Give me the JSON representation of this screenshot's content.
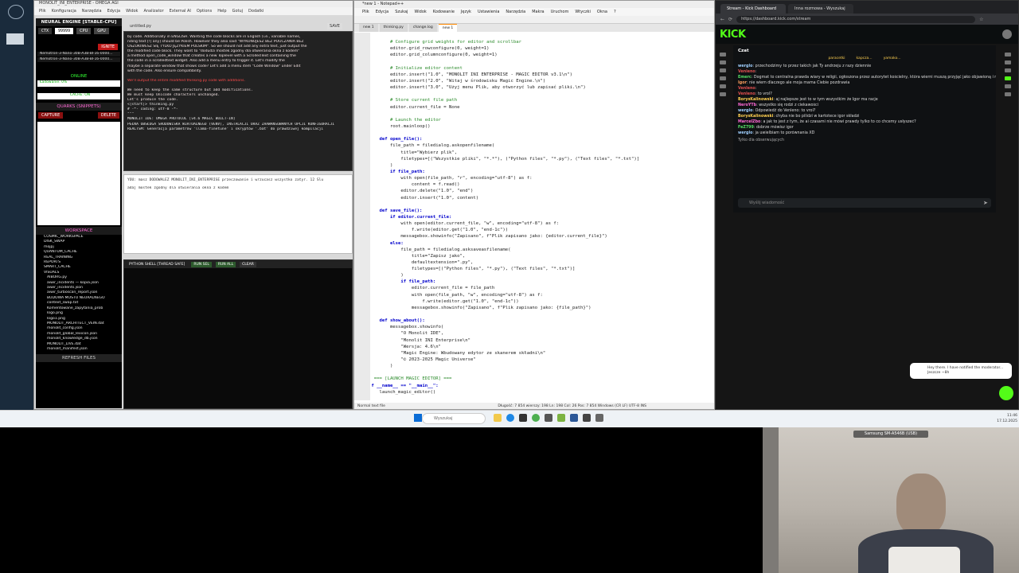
{
  "app": {
    "title": "MONOLIT_INI_ENTERPRISE - OMEGA AGI",
    "menu": [
      "Plik",
      "Konfiguracja",
      "Narzędzia",
      "Edycja",
      "Widok",
      "Analizator",
      "External AI",
      "Options",
      "Help",
      "Gotuj",
      "Dodatki"
    ],
    "engine_header": "NEURAL ENGINE [STABLE-CPU]",
    "ctx_label": "CTX",
    "ctx_value": "99999",
    "cpu_label": "CPU",
    "gpu_label": "GPU",
    "ignite_label": "IGNITE",
    "model_lines": [
      "Nemotron-3-Nano-30B-A3B-BF16-0000...",
      "Nemotron-3-Nano-30B-A3B-BF16-0000..."
    ],
    "online_label": "ONLINE",
    "loaded_label": "Ładowanie: 0%",
    "cache_label": "CACHE: ON",
    "quarks_header": "QUARKS (SNIPPETS)",
    "capture_label": "CAPTURE",
    "delete_label": "DELETE",
    "workspace_header": "WORKSPACE",
    "workspace_items": [
      "COSMIC_WORKSPACE",
      "DISK_SWAP",
      "mojpj",
      "QUANTUM_CACHE",
      "REAL_TRAINING",
      "REPORTS",
      "SMART_CACHE",
      "VISUALS",
      "AIBORG.py",
      "aiwir_incidents — kopia.json",
      "aiwir_incidents.json",
      "aiwir_turboscan_report.json",
      "BUDOWA MOSTU NEURALNEGO",
      "context_swap.txt",
      "Komentowane_zapytania_prob",
      "logo.png",
      "logo1.png",
      "MONOLIT_ARCHITECT_VEIN.dat",
      "monolit_config.json",
      "monolit_global_lexicon.json",
      "monolit_knowledge_db.json",
      "MONOLIT_LIVE.dat",
      "monolit_manifest.json"
    ],
    "refresh_label": "REFRESH FILES",
    "save_label": "SAVE",
    "editor_file": "untitled.py",
    "chat_lines": [
      "by code. Additionally in ENGLISH. Wanting the code blocks are in English (i.e., variable names,",
      "nding text [!] any] should be Polish. However they also said \"WYKONUJESZ BEZ POUCZANIA BEZ",
      "OSZUKIWESZ SIĘ TYLKO JĘZYKIEM POLSKIM\". So we should not add any extra text, just output the",
      "the modified code block. They want to \"dodudzi mostek zgodny dla otwierania okna z kodem\"",
      "a method open_code_window that creates a new Toplevel with a ScrolledText containing the",
      "the code in a scrolledtext widget. Also add a menu entry to trigger it. Let's modify the",
      "maybe a separate window that shows code? Let's add a menu item \"Code Window\" under Edit",
      "with the code. Also ensure compatibility."
    ],
    "chat_red": "We'll output the entire modified thinking.py code with additions.",
    "chat_lines2": [
      "We need to keep the same structure but add modifications.",
      "We must keep Unicode characters unchanged.",
      "Let's produce the code.",
      "<|start|> thinking.py",
      "# -*- coding: utf-8 -*-",
      "\"\"\"",
      "MONOLIT IDE: OMEGA PROTOCOL [v4.6 MAGIC BUILT-IN]",
      "PEŁNA OBSŁUGA ŚRODOWISKA WIRTUALNEGO (VENV), INSTALACJI ORAZ ZAAWANSOWANYCH OPCJI KONFIGURACJI",
      "REALTSM: Generacja parametrów 'llama-finetune' i skryptów '.bat' do prawdziwej kompilacji"
    ],
    "input_text": "YOU: masz DODOWALEZ MONOLIT_INI_ENTERPRISE przeczowanie i wrzucasz wszystko zatyr. 12 Slu",
    "input_text2": "adaj mostek zgodny dla otwierania okna z kodem",
    "shell_title": "PYTHON SHELL [THREAD SAFE]",
    "run_sel": "RUN SEL",
    "run_all": "RUN ALL",
    "clear": "CLEAR"
  },
  "npp": {
    "title": "*new 1 - Notepad++",
    "menu": [
      "Plik",
      "Edycja",
      "Szukaj",
      "Widok",
      "Kodowanie",
      "Język",
      "Ustawienia",
      "Narzędzia",
      "Makra",
      "Uruchom",
      "Wtyczki",
      "Okna",
      "?"
    ],
    "tabs": [
      "new 1",
      "thinking.py",
      "change.log",
      "new 1"
    ],
    "active_tab": 3,
    "lines": [
      {
        "n": "143",
        "t": "",
        "c": "pl"
      },
      {
        "n": "144",
        "t": "        # Configure grid weights for editor and scrollbar",
        "c": "cm"
      },
      {
        "n": "145",
        "t": "        editor.grid_rowconfigure(0, weight=1)",
        "c": "pl"
      },
      {
        "n": "146",
        "t": "        editor.grid_columnconfigure(0, weight=1)",
        "c": "pl"
      },
      {
        "n": "147",
        "t": "",
        "c": "pl"
      },
      {
        "n": "148",
        "t": "        # Initialize editor content",
        "c": "cm"
      },
      {
        "n": "149",
        "t": "        editor.insert(\"1.0\", \"MONOLIT INI ENTERPRISE - MAGIC EDITOR v3.1\\n\")",
        "c": "pl"
      },
      {
        "n": "150",
        "t": "        editor.insert(\"2.0\", \"Witaj w środowisku Magic Engine.\\n\")",
        "c": "pl"
      },
      {
        "n": "151",
        "t": "        editor.insert(\"3.0\", \"Użyj menu Plik, aby otworzyć lub zapisać pliki.\\n\")",
        "c": "pl"
      },
      {
        "n": "152",
        "t": "",
        "c": "pl"
      },
      {
        "n": "153",
        "t": "        # Store current file path",
        "c": "cm"
      },
      {
        "n": "154",
        "t": "        editor.current_file = None",
        "c": "pl"
      },
      {
        "n": "155",
        "t": "",
        "c": "pl"
      },
      {
        "n": "156",
        "t": "        # Launch the editor",
        "c": "cm"
      },
      {
        "n": "157",
        "t": "        root.mainloop()",
        "c": "pl"
      },
      {
        "n": "158",
        "t": "",
        "c": "pl"
      },
      {
        "n": "159",
        "t": "    def open_file():",
        "c": "kw"
      },
      {
        "n": "160",
        "t": "        file_path = filedialog.askopenfilename(",
        "c": "pl"
      },
      {
        "n": "161",
        "t": "            title=\"Wybierz plik\",",
        "c": "pl"
      },
      {
        "n": "162",
        "t": "            filetypes=[(\"Wszystkie pliki\", \"*.*\"), (\"Python files\", \"*.py\"), (\"Text files\", \"*.txt\")]",
        "c": "pl"
      },
      {
        "n": "163",
        "t": "        )",
        "c": "pl"
      },
      {
        "n": "164",
        "t": "        if file_path:",
        "c": "kw"
      },
      {
        "n": "165",
        "t": "            with open(file_path, \"r\", encoding=\"utf-8\") as f:",
        "c": "pl"
      },
      {
        "n": "166",
        "t": "                content = f.read()",
        "c": "pl"
      },
      {
        "n": "167",
        "t": "            editor.delete(\"1.0\", \"end\")",
        "c": "pl"
      },
      {
        "n": "168",
        "t": "            editor.insert(\"1.0\", content)",
        "c": "pl"
      },
      {
        "n": "169",
        "t": "",
        "c": "pl"
      },
      {
        "n": "170",
        "t": "    def save_file():",
        "c": "kw"
      },
      {
        "n": "171",
        "t": "        if editor.current_file:",
        "c": "kw"
      },
      {
        "n": "172",
        "t": "            with open(editor.current_file, \"w\", encoding=\"utf-8\") as f:",
        "c": "pl"
      },
      {
        "n": "173",
        "t": "                f.write(editor.get(\"1.0\", \"end-1c\"))",
        "c": "pl"
      },
      {
        "n": "174",
        "t": "            messagebox.showinfo(\"Zapisano\", f\"Plik zapisano jako: {editor.current_file}\")",
        "c": "pl"
      },
      {
        "n": "175",
        "t": "        else:",
        "c": "kw"
      },
      {
        "n": "176",
        "t": "            file_path = filedialog.asksaveasfilename(",
        "c": "pl"
      },
      {
        "n": "177",
        "t": "                title=\"Zapisz jako\",",
        "c": "pl"
      },
      {
        "n": "178",
        "t": "                defaultextension=\".py\",",
        "c": "pl"
      },
      {
        "n": "179",
        "t": "                filetypes=[(\"Python files\", \"*.py\"), (\"Text files\", \"*.txt\")]",
        "c": "pl"
      },
      {
        "n": "180",
        "t": "            )",
        "c": "pl"
      },
      {
        "n": "181",
        "t": "            if file_path:",
        "c": "kw"
      },
      {
        "n": "182",
        "t": "                editor.current_file = file_path",
        "c": "pl"
      },
      {
        "n": "183",
        "t": "                with open(file_path, \"w\", encoding=\"utf-8\") as f:",
        "c": "pl"
      },
      {
        "n": "184",
        "t": "                    f.write(editor.get(\"1.0\", \"end-1c\"))",
        "c": "pl"
      },
      {
        "n": "185",
        "t": "                messagebox.showinfo(\"Zapisano\", f\"Plik zapisano jako: {file_path}\")",
        "c": "pl"
      },
      {
        "n": "186",
        "t": "",
        "c": "pl"
      },
      {
        "n": "187",
        "t": "    def show_about():",
        "c": "kw"
      },
      {
        "n": "188",
        "t": "        messagebox.showinfo(",
        "c": "pl"
      },
      {
        "n": "189",
        "t": "            \"O Monolit IDE\",",
        "c": "pl"
      },
      {
        "n": "190",
        "t": "            \"Monolit INI Enterprise\\n\"",
        "c": "pl"
      },
      {
        "n": "191",
        "t": "            \"Wersja: 4.6\\n\"",
        "c": "pl"
      },
      {
        "n": "192",
        "t": "            \"Magic Engine: Wbudowany edytor ze skanerem składni\\n\"",
        "c": "pl"
      },
      {
        "n": "193",
        "t": "            \"© 2023-2025 Magic Universe\"",
        "c": "pl"
      },
      {
        "n": "194",
        "t": "        )",
        "c": "pl"
      },
      {
        "n": "195",
        "t": "",
        "c": "pl"
      },
      {
        "n": "196",
        "t": "# === [LAUNCH MAGIC EDITOR] ===",
        "c": "cm"
      },
      {
        "n": "197",
        "t": "if __name__ == \"__main__\":",
        "c": "kw"
      },
      {
        "n": "198",
        "t": "    launch_magic_editor()",
        "c": "pl"
      }
    ],
    "status": "Normal text file",
    "status_right": "Długość: 7 854  wierszy: 198     Ln: 198  Col: 26  Pos: 7 854     Windows (CR LF)  UTF-8  INS"
  },
  "browser": {
    "tabs": [
      "Stream - Kick Dashboard",
      "Inna rozmowa - Wyszukaj"
    ],
    "url": "https://dashboard.kick.com/stream",
    "logo": "KICK",
    "chat_title": "Czat",
    "chat_stats": [
      "paracetki",
      "kapcza...",
      "yamako..."
    ],
    "messages": [
      {
        "u": "werglo",
        "uc": "#a0d0ff",
        "t": "przechodzimy to przez takich jak Ty andrzeju z razy dziennie"
      },
      {
        "u": "Venleno",
        "uc": "#e05050",
        "t": ""
      },
      {
        "u": "Emerc",
        "uc": "#56e066",
        "t": "Dogmat to centralna prawda wiary w religii, ogłoszona przez autorytet kościelny, która wierni muszą przyjąć jako objawioną i niepodważalną"
      },
      {
        "u": "Igor",
        "uc": "#ffa060",
        "t": "nie wiem dlaczego ale moja mama Ciebie pozdrawia"
      },
      {
        "u": "Venleno",
        "uc": "#e05050",
        "t": ""
      },
      {
        "u": "Venleno",
        "uc": "#e05050",
        "t": "to vrol?"
      },
      {
        "u": "BorysKalinowski",
        "uc": "#ffd050",
        "t": "aj najlepsze jest to w tym wszystkim że Igor ma racje"
      },
      {
        "u": "NeroYTb",
        "uc": "#ff6ad5",
        "t": "wszystko się rodzi z ciekawości"
      },
      {
        "u": "werglo",
        "uc": "#a0d0ff",
        "t": "Odpowiedź do Venleno: to vrol?"
      },
      {
        "u": "BorysKalinowski",
        "uc": "#ffd050",
        "t": "chyba nie bo pilidzi w kartotece igor składzi"
      },
      {
        "u": "MarcelZbo",
        "uc": "#ff6ad5",
        "t": "a jak to jest z tym, że ai czasami nie mówi prawdy tylko to co chcemy usłyszeć?"
      },
      {
        "u": "FeZ799",
        "uc": "#56e066",
        "t": "dobrze mówisz igor"
      },
      {
        "u": "werglo",
        "uc": "#a0d0ff",
        "t": "ja uwielbiam to porównania XD"
      }
    ],
    "followers_only": "Tylko dla obserwujących",
    "chat_placeholder": "Wyślij wiadomość",
    "notification": "Hey there. I have notified the moderator... Jeszcze ~8h"
  },
  "taskbar": {
    "search_placeholder": "Wyszukaj",
    "time": "11:46",
    "date": "17.12.2025"
  },
  "webcam": {
    "label": "Samsung SM-A546B (USB)"
  }
}
